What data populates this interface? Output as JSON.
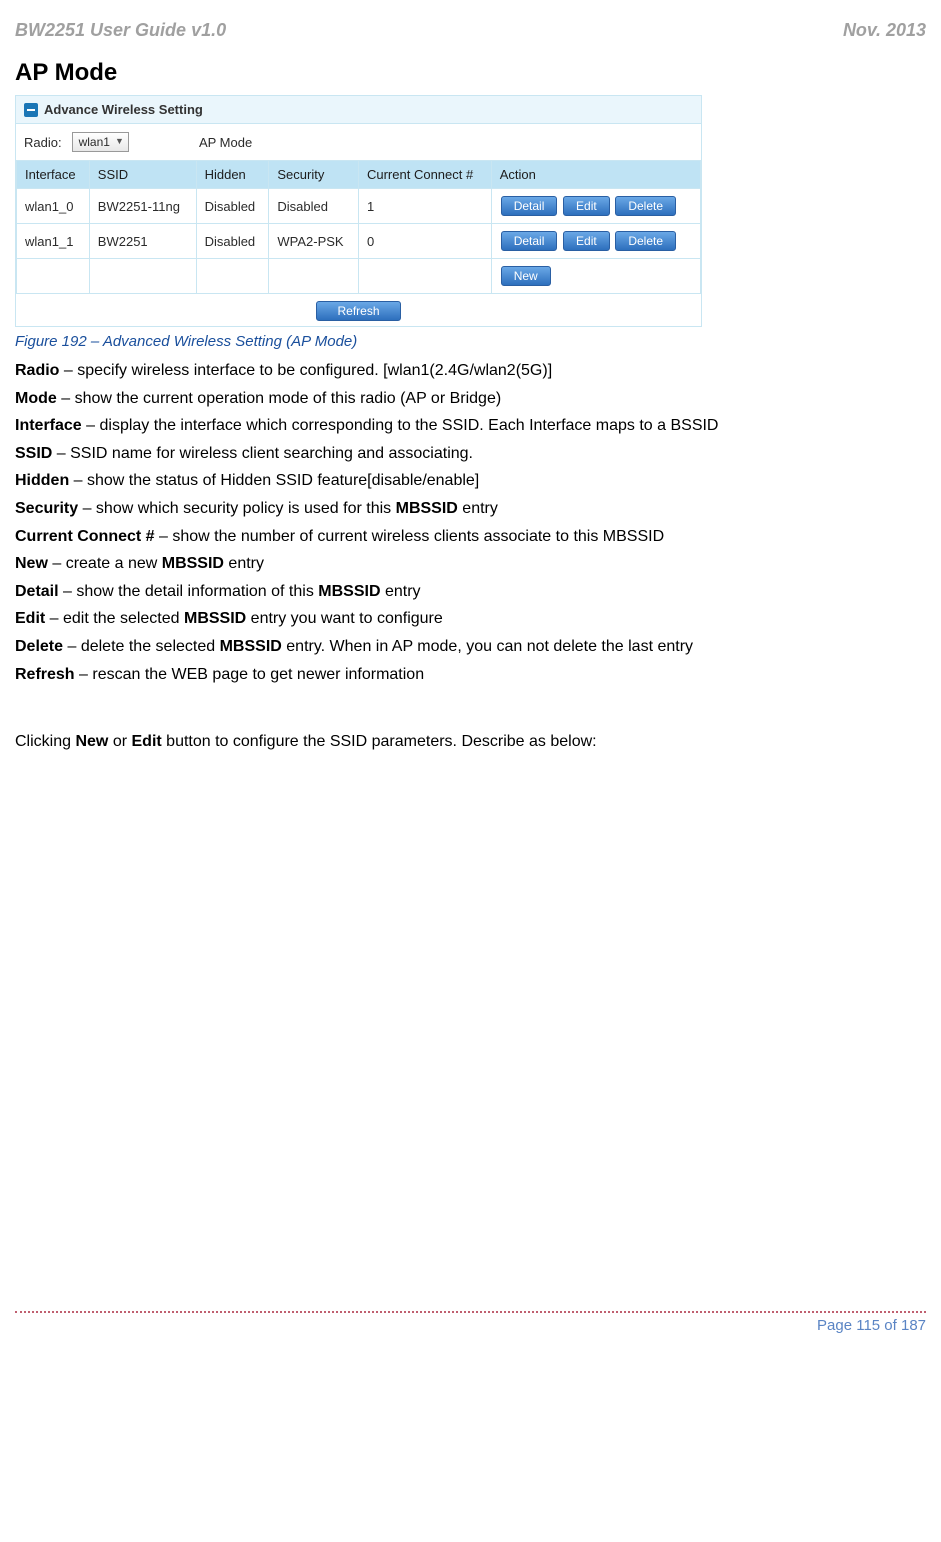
{
  "header": {
    "left": "BW2251 User Guide v1.0",
    "right": "Nov.  2013"
  },
  "section_title": "AP Mode",
  "panel": {
    "title": "Advance Wireless Setting",
    "radio_label": "Radio:",
    "radio_value": "wlan1",
    "mode_label": "AP Mode",
    "columns": {
      "interface": "Interface",
      "ssid": "SSID",
      "hidden": "Hidden",
      "security": "Security",
      "current": "Current Connect #",
      "action": "Action"
    },
    "rows": [
      {
        "iface": "wlan1_0",
        "ssid": "BW2251-11ng",
        "hidden": "Disabled",
        "sec": "Disabled",
        "cc": "1"
      },
      {
        "iface": "wlan1_1",
        "ssid": "BW2251",
        "hidden": "Disabled",
        "sec": "WPA2-PSK",
        "cc": "0"
      }
    ],
    "buttons": {
      "detail": "Detail",
      "edit": "Edit",
      "delete": "Delete",
      "new": "New",
      "refresh": "Refresh"
    }
  },
  "figure_caption": "Figure 192 – Advanced Wireless Setting (AP Mode)",
  "definitions": [
    {
      "term": "Radio",
      "desc": " – specify wireless interface to be configured. [wlan1(2.4G/wlan2(5G)]"
    },
    {
      "term": "Mode",
      "desc": " – show the current operation mode of this radio (AP or Bridge)"
    },
    {
      "term": "Interface",
      "desc": " – display the interface which corresponding to the SSID. Each Interface maps to a BSSID"
    },
    {
      "term": "SSID",
      "desc": " – SSID name for wireless client searching and associating."
    },
    {
      "term": "Hidden",
      "desc": " – show the status of Hidden SSID feature[disable/enable]"
    }
  ],
  "security_line": {
    "term": "Security",
    "mid": " – show which security policy is used for this ",
    "bold": "MBSSID",
    "tail": " entry"
  },
  "current_line": {
    "term": "Current Connect #",
    "desc": " – show the number of current wireless clients associate to  this MBSSID"
  },
  "new_line": {
    "term": "New",
    "mid": " – create a new ",
    "bold": "MBSSID",
    "tail": " entry"
  },
  "detail_line": {
    "term": "Detail",
    "mid": " – show the detail information of this ",
    "bold": "MBSSID",
    "tail": " entry"
  },
  "edit_line": {
    "term": "Edit",
    "mid": " – edit the selected ",
    "bold": "MBSSID",
    "tail": " entry you want to configure"
  },
  "delete_line": {
    "term": "Delete",
    "mid": " – delete the selected ",
    "bold": "MBSSID",
    "tail": " entry. When in AP mode, you can not delete the last entry"
  },
  "refresh_line": {
    "term": "Refresh",
    "desc": " – rescan the WEB page to get newer information"
  },
  "body_text": {
    "pre": "Clicking ",
    "b1": "New",
    "mid": " or ",
    "b2": "Edit",
    "post": " button to configure the SSID parameters. Describe as below:"
  },
  "footer": {
    "page": "Page 115 of 187"
  }
}
